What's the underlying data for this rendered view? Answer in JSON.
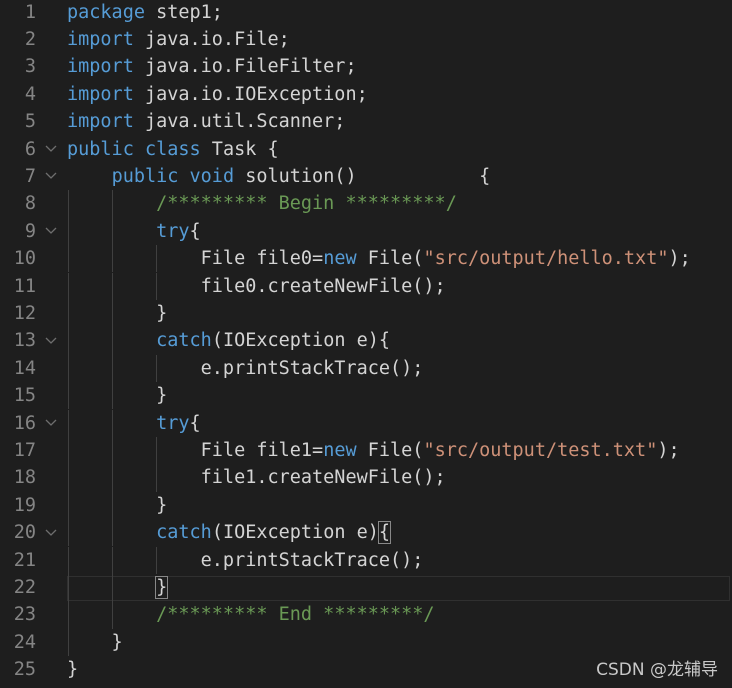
{
  "editor": {
    "lines": [
      {
        "n": "1",
        "fold": false,
        "guides": 0,
        "tokens": [
          [
            "kw",
            "package"
          ],
          [
            "plain",
            " step1;"
          ]
        ]
      },
      {
        "n": "2",
        "fold": false,
        "guides": 0,
        "tokens": [
          [
            "kw",
            "import"
          ],
          [
            "plain",
            " java.io.File;"
          ]
        ]
      },
      {
        "n": "3",
        "fold": false,
        "guides": 0,
        "tokens": [
          [
            "kw",
            "import"
          ],
          [
            "plain",
            " java.io.FileFilter;"
          ]
        ]
      },
      {
        "n": "4",
        "fold": false,
        "guides": 0,
        "tokens": [
          [
            "kw",
            "import"
          ],
          [
            "plain",
            " java.io.IOException;"
          ]
        ]
      },
      {
        "n": "5",
        "fold": false,
        "guides": 0,
        "tokens": [
          [
            "kw",
            "import"
          ],
          [
            "plain",
            " java.util.Scanner;"
          ]
        ]
      },
      {
        "n": "6",
        "fold": true,
        "guides": 0,
        "tokens": [
          [
            "kw",
            "public"
          ],
          [
            "plain",
            " "
          ],
          [
            "kw",
            "class"
          ],
          [
            "plain",
            " Task {"
          ]
        ]
      },
      {
        "n": "7",
        "fold": true,
        "guides": 0,
        "tokens": [
          [
            "plain",
            "    "
          ],
          [
            "kw",
            "public"
          ],
          [
            "plain",
            " "
          ],
          [
            "kw",
            "void"
          ],
          [
            "plain",
            " solution()           {"
          ]
        ]
      },
      {
        "n": "8",
        "fold": false,
        "guides": 2,
        "tokens": [
          [
            "plain",
            "        "
          ],
          [
            "cmt",
            "/********* Begin *********/"
          ]
        ]
      },
      {
        "n": "9",
        "fold": true,
        "guides": 2,
        "tokens": [
          [
            "plain",
            "        "
          ],
          [
            "kw",
            "try"
          ],
          [
            "plain",
            "{"
          ]
        ]
      },
      {
        "n": "10",
        "fold": false,
        "guides": 3,
        "tokens": [
          [
            "plain",
            "            File file0="
          ],
          [
            "kw",
            "new"
          ],
          [
            "plain",
            " File("
          ],
          [
            "str",
            "\"src/output/hello.txt\""
          ],
          [
            "plain",
            ");"
          ]
        ]
      },
      {
        "n": "11",
        "fold": false,
        "guides": 3,
        "tokens": [
          [
            "plain",
            "            file0.createNewFile();"
          ]
        ]
      },
      {
        "n": "12",
        "fold": false,
        "guides": 2,
        "tokens": [
          [
            "plain",
            "        }"
          ]
        ]
      },
      {
        "n": "13",
        "fold": true,
        "guides": 2,
        "tokens": [
          [
            "plain",
            "        "
          ],
          [
            "kw",
            "catch"
          ],
          [
            "plain",
            "(IOException e){"
          ]
        ]
      },
      {
        "n": "14",
        "fold": false,
        "guides": 3,
        "tokens": [
          [
            "plain",
            "            e.printStackTrace();"
          ]
        ]
      },
      {
        "n": "15",
        "fold": false,
        "guides": 2,
        "tokens": [
          [
            "plain",
            "        }"
          ]
        ]
      },
      {
        "n": "16",
        "fold": true,
        "guides": 2,
        "tokens": [
          [
            "plain",
            "        "
          ],
          [
            "kw",
            "try"
          ],
          [
            "plain",
            "{"
          ]
        ]
      },
      {
        "n": "17",
        "fold": false,
        "guides": 3,
        "tokens": [
          [
            "plain",
            "            File file1="
          ],
          [
            "kw",
            "new"
          ],
          [
            "plain",
            " File("
          ],
          [
            "str",
            "\"src/output/test.txt\""
          ],
          [
            "plain",
            ");"
          ]
        ]
      },
      {
        "n": "18",
        "fold": false,
        "guides": 3,
        "tokens": [
          [
            "plain",
            "            file1.createNewFile();"
          ]
        ]
      },
      {
        "n": "19",
        "fold": false,
        "guides": 2,
        "tokens": [
          [
            "plain",
            "        }"
          ]
        ]
      },
      {
        "n": "20",
        "fold": true,
        "guides": 2,
        "tokens": [
          [
            "plain",
            "        "
          ],
          [
            "kw",
            "catch"
          ],
          [
            "plain",
            "(IOException e)"
          ],
          [
            "match",
            "{"
          ]
        ]
      },
      {
        "n": "21",
        "fold": false,
        "guides": 3,
        "tokens": [
          [
            "plain",
            "            e.printStackTrace();"
          ]
        ]
      },
      {
        "n": "22",
        "fold": false,
        "guides": 2,
        "tokens": [
          [
            "plain",
            "        "
          ],
          [
            "match",
            "}"
          ]
        ]
      },
      {
        "n": "23",
        "fold": false,
        "guides": 2,
        "tokens": [
          [
            "plain",
            "        "
          ],
          [
            "cmt",
            "/********* End *********/"
          ]
        ]
      },
      {
        "n": "24",
        "fold": false,
        "guides": 1,
        "tokens": [
          [
            "plain",
            "    }"
          ]
        ]
      },
      {
        "n": "25",
        "fold": false,
        "guides": 0,
        "tokens": [
          [
            "plain",
            "}"
          ]
        ]
      }
    ],
    "current_line": "22",
    "fold_icon": "chevron-down-icon"
  },
  "watermark": "CSDN @龙辅导",
  "colors": {
    "background": "#1e1e1e",
    "keyword": "#569cd6",
    "string": "#ce9178",
    "comment": "#6a9955",
    "text": "#d4d4d4",
    "line_number": "#858585"
  }
}
